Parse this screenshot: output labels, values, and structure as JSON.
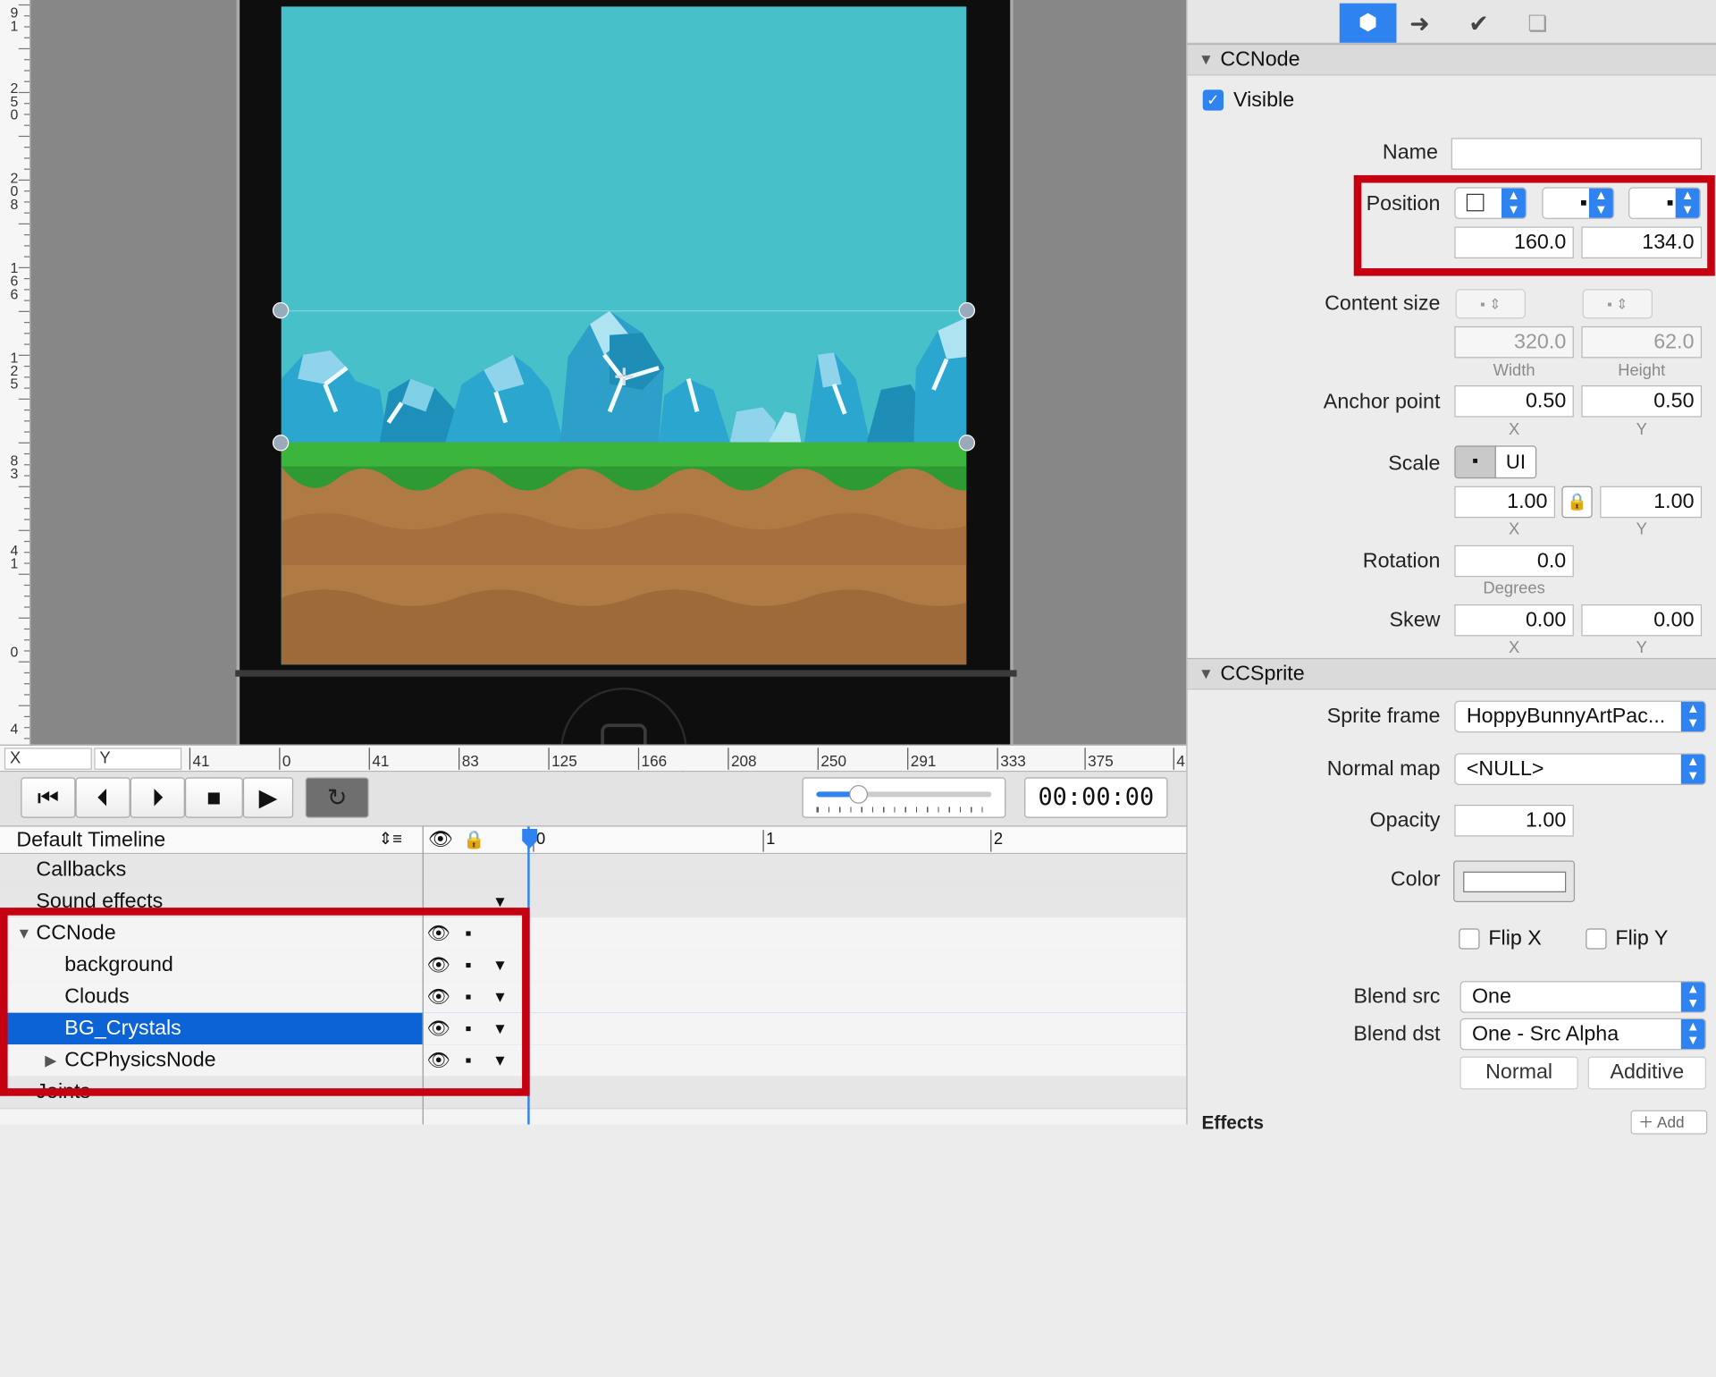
{
  "ruler_vertical": [
    "9",
    "1",
    "2",
    "5",
    "0",
    "2",
    "0",
    "8",
    "1",
    "6",
    "6",
    "1",
    "2",
    "5",
    "8",
    "3",
    "4",
    "1",
    "0",
    "4"
  ],
  "ruler_horizontal": {
    "x_label": "X",
    "y_label": "Y",
    "ticks": [
      "41",
      "0",
      "41",
      "83",
      "125",
      "166",
      "208",
      "250",
      "291",
      "333",
      "375",
      "4"
    ]
  },
  "toolbar": {
    "time": "00:00:00",
    "playback_icons": [
      "skip-to-start-icon",
      "step-back-icon",
      "step-forward-icon",
      "stop-icon",
      "play-icon",
      "loop-icon"
    ]
  },
  "timeline": {
    "name": "Default Timeline",
    "rows": [
      "Callbacks",
      "Sound effects",
      "CCNode",
      "background",
      "Clouds",
      "BG_Crystals",
      "CCPhysicsNode",
      "Joints"
    ],
    "ruler": [
      "0",
      "1",
      "2"
    ]
  },
  "inspector": {
    "tabs": [
      "node-properties-icon",
      "code-connections-icon",
      "physics-icon",
      "templates-icon"
    ],
    "ccnode": {
      "header": "CCNode",
      "visible_label": "Visible",
      "visible": true,
      "name_label": "Name",
      "name_value": "",
      "position_label": "Position",
      "position_x": "160.0",
      "position_y": "134.0",
      "content_size_label": "Content size",
      "width": "320.0",
      "height": "62.0",
      "width_cap": "Width",
      "height_cap": "Height",
      "anchor_label": "Anchor point",
      "anchor_x": "0.50",
      "anchor_y": "0.50",
      "x_cap": "X",
      "y_cap": "Y",
      "scale_label": "Scale",
      "scale_ui": "UI",
      "scale_x": "1.00",
      "scale_y": "1.00",
      "rotation_label": "Rotation",
      "rotation": "0.0",
      "degrees_cap": "Degrees",
      "skew_label": "Skew",
      "skew_x": "0.00",
      "skew_y": "0.00"
    },
    "ccsprite": {
      "header": "CCSprite",
      "sprite_frame_label": "Sprite frame",
      "sprite_frame": "HoppyBunnyArtPac...",
      "normal_map_label": "Normal map",
      "normal_map": "<NULL>",
      "opacity_label": "Opacity",
      "opacity": "1.00",
      "color_label": "Color",
      "color_value": "#ffffff",
      "flip_x": "Flip X",
      "flip_y": "Flip Y",
      "blend_src_label": "Blend src",
      "blend_src": "One",
      "blend_dst_label": "Blend dst",
      "blend_dst": "One - Src Alpha",
      "normal_btn": "Normal",
      "additive_btn": "Additive"
    },
    "effects_label": "Effects",
    "add_label": "Add"
  },
  "colors": {
    "accent": "#2f83f1",
    "highlight": "#c50010",
    "sky": "#47c0ca",
    "grass": "#3cb53c",
    "dirt": "#b07a44"
  }
}
